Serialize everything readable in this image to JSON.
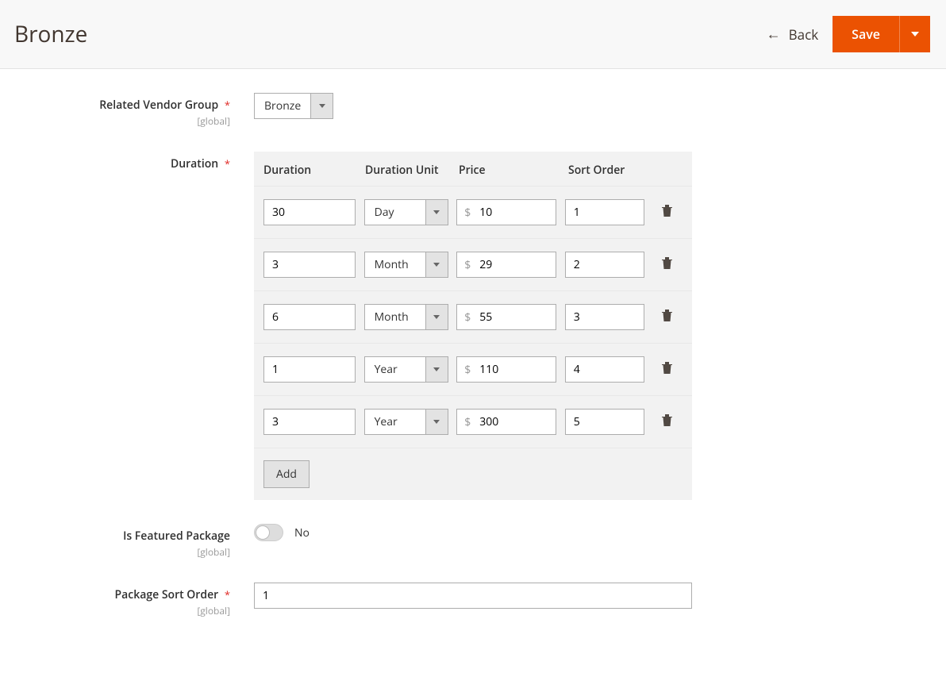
{
  "header": {
    "title": "Bronze",
    "back_label": "Back",
    "save_label": "Save"
  },
  "fields": {
    "vendor_group": {
      "label": "Related Vendor Group",
      "scope": "[global]",
      "value": "Bronze"
    },
    "duration": {
      "label": "Duration",
      "columns": {
        "duration": "Duration",
        "unit": "Duration Unit",
        "price": "Price",
        "sort": "Sort Order"
      },
      "currency": "$",
      "rows": [
        {
          "duration": "30",
          "unit": "Day",
          "price": "10",
          "sort": "1"
        },
        {
          "duration": "3",
          "unit": "Month",
          "price": "29",
          "sort": "2"
        },
        {
          "duration": "6",
          "unit": "Month",
          "price": "55",
          "sort": "3"
        },
        {
          "duration": "1",
          "unit": "Year",
          "price": "110",
          "sort": "4"
        },
        {
          "duration": "3",
          "unit": "Year",
          "price": "300",
          "sort": "5"
        }
      ],
      "add_label": "Add"
    },
    "featured": {
      "label": "Is Featured Package",
      "scope": "[global]",
      "state_label": "No"
    },
    "sort_order": {
      "label": "Package Sort Order",
      "scope": "[global]",
      "value": "1"
    }
  }
}
